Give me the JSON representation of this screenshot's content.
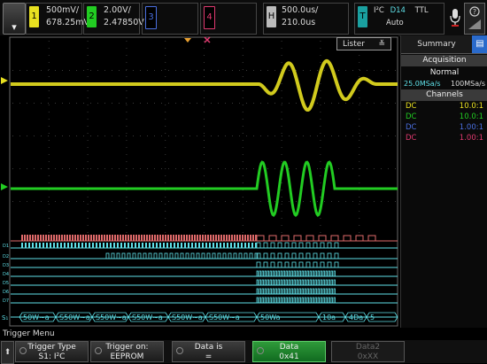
{
  "colors": {
    "ch1": "#e8e020",
    "ch2": "#22cc22",
    "ch3": "#4a6fe0",
    "ch4": "#e03a70",
    "digital": "#5fe0e8",
    "accent": "#2a6acb"
  },
  "menu_icon": "chevron-down-icon",
  "channels": [
    {
      "num": "1",
      "scale": "500mV/",
      "offset": "678.25mV"
    },
    {
      "num": "2",
      "scale": "2.00V/",
      "offset": "2.47850V"
    },
    {
      "num": "3"
    },
    {
      "num": "4"
    }
  ],
  "horizontal": {
    "label": "H",
    "scale": "500.0us/",
    "delay": "210.0us"
  },
  "trigger": {
    "label": "T",
    "protocol": "I²C",
    "dchan": "D14",
    "level": "TTL",
    "mode": "Auto"
  },
  "lister": {
    "label": "Lister"
  },
  "summary": {
    "tab": "Summary",
    "acquisition": {
      "header": "Acquisition",
      "mode": "Normal",
      "rate1": "25.0MSa/s",
      "rate2": "100MSa/s"
    },
    "channels_header": "Channels",
    "rows": [
      {
        "coupling": "DC",
        "ratio": "10.0:1"
      },
      {
        "coupling": "DC",
        "ratio": "10.0:1"
      },
      {
        "coupling": "DC",
        "ratio": "1.00:1"
      },
      {
        "coupling": "DC",
        "ratio": "1.00:1"
      }
    ]
  },
  "decode": {
    "label": "S₁",
    "segments": [
      "50W~a",
      "S50W~a",
      "S50W~a",
      "S50W~a",
      "S50W~a",
      "S50W~a",
      "50Wa",
      "10a",
      "4Da",
      "5"
    ]
  },
  "softkeys": {
    "menu_title": "Trigger Menu",
    "keys": [
      {
        "top": "Trigger Type",
        "bottom": "S1: I²C"
      },
      {
        "top": "Trigger on:",
        "bottom": "EEPROM"
      },
      {
        "top": "Data is",
        "bottom": "="
      },
      {
        "top": "Data",
        "bottom": "0x41"
      },
      {
        "top": "Data2",
        "bottom": "0xXX"
      }
    ]
  }
}
